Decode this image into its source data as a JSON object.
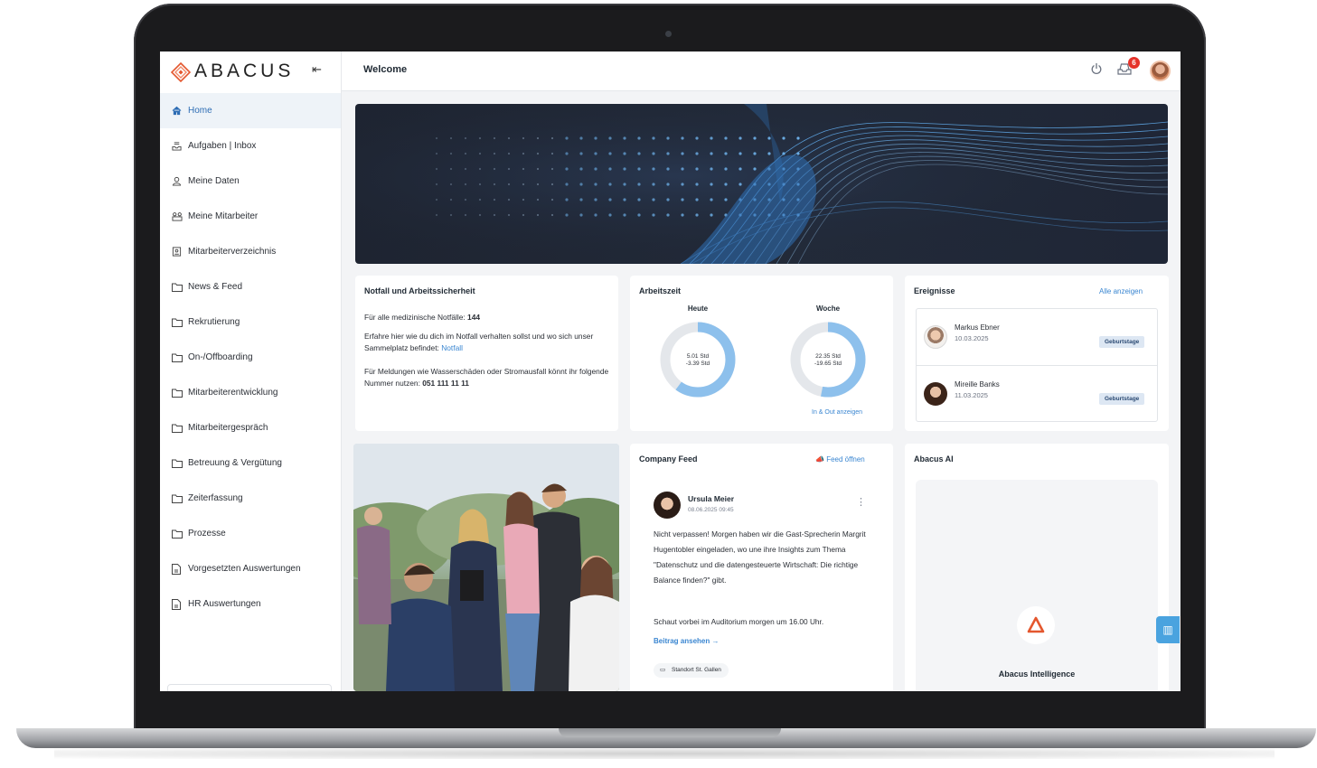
{
  "brand": {
    "name": "ABACUS",
    "accent": "#2e6db4",
    "link": "#3a86d1",
    "badge": "#e5332a"
  },
  "topbar": {
    "title": "Welcome",
    "notification_count": "6"
  },
  "sidebar": {
    "items": [
      {
        "label": "Home",
        "icon": "home-icon",
        "active": true
      },
      {
        "label": "Aufgaben | Inbox",
        "icon": "inbox-icon"
      },
      {
        "label": "Meine Daten",
        "icon": "person-icon"
      },
      {
        "label": "Meine Mitarbeiter",
        "icon": "team-icon"
      },
      {
        "label": "Mitarbeiterverzeichnis",
        "icon": "directory-icon"
      },
      {
        "label": "News & Feed",
        "icon": "folder-icon"
      },
      {
        "label": "Rekrutierung",
        "icon": "folder-icon"
      },
      {
        "label": "On-/Offboarding",
        "icon": "folder-icon"
      },
      {
        "label": "Mitarbeiterentwicklung",
        "icon": "folder-icon"
      },
      {
        "label": "Mitarbeitergespräch",
        "icon": "folder-icon"
      },
      {
        "label": "Betreuung & Vergütung",
        "icon": "folder-icon"
      },
      {
        "label": "Zeiterfassung",
        "icon": "folder-icon"
      },
      {
        "label": "Prozesse",
        "icon": "folder-icon"
      },
      {
        "label": "Vorgesetzten Auswertungen",
        "icon": "report-icon"
      },
      {
        "label": "HR Auswertungen",
        "icon": "report-icon"
      }
    ]
  },
  "notfall": {
    "title": "Notfall und Arbeitssicherheit",
    "line1_prefix": "Für alle medizinische Notfälle:",
    "line1_number": "144",
    "line2_text": "Erfahre hier wie du dich im Notfall verhalten sollst und wo sich unser Sammelplatz befindet:",
    "line2_link": "Notfall",
    "line3_text": "Für Meldungen wie Wasserschäden oder Stromausfall könnt ihr folgende Nummer nutzen:",
    "line3_number": "051 111 11 11"
  },
  "arbeitszeit": {
    "title": "Arbeitszeit",
    "today": {
      "label": "Heute",
      "value": "5.01 Std",
      "delta": "-3.39 Std",
      "fraction": 0.6
    },
    "week": {
      "label": "Woche",
      "value": "22.35 Std",
      "delta": "-19.65 Std",
      "fraction": 0.53
    },
    "link": "In & Out anzeigen"
  },
  "ereignisse": {
    "title": "Ereignisse",
    "link": "Alle anzeigen",
    "items": [
      {
        "name": "Markus Ebner",
        "date": "10.03.2025",
        "tag": "Geburtstage"
      },
      {
        "name": "Mireille Banks",
        "date": "11.03.2025",
        "tag": "Geburtstage"
      }
    ]
  },
  "feed": {
    "title": "Company Feed",
    "link": "Feed öffnen",
    "author": "Ursula Meier",
    "date": "08.06.2025 09:45",
    "text": "Nicht verpassen! Morgen haben wir die Gast-Sprecherin Margrit Hugentobler eingeladen, wo une ihre Insights zum Thema \"Datenschutz und die datengesteuerte Wirtschaft: Die richtige Balance finden?\" gibt.",
    "text2": "Schaut vorbei im Auditorium morgen um 16.00 Uhr.",
    "more": "Beitrag ansehen",
    "location": "Standort St. Gallen"
  },
  "ai": {
    "title": "Abacus AI",
    "name": "Abacus Intelligence"
  }
}
